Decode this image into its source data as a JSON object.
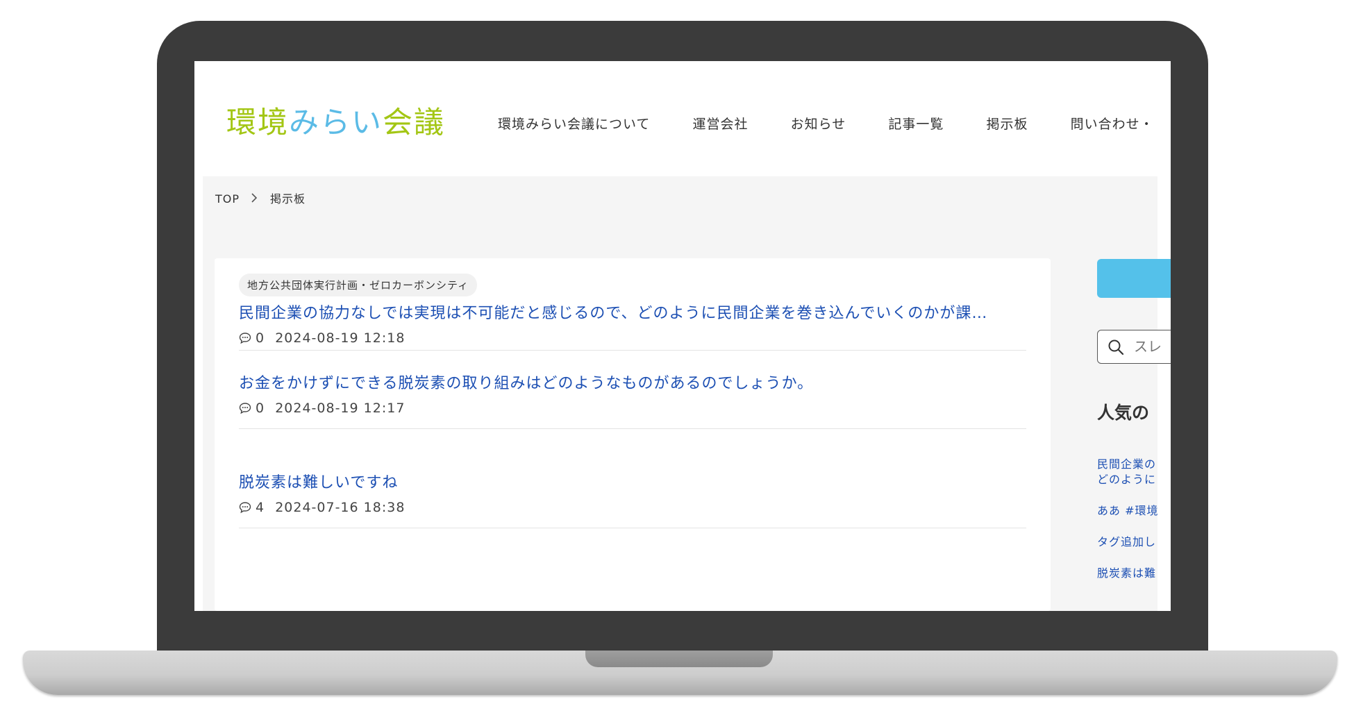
{
  "header": {
    "logo": {
      "part1": "環境",
      "part2": "みらい",
      "part3": "会議"
    },
    "nav": [
      "環境みらい会議について",
      "運営会社",
      "お知らせ",
      "記事一覧",
      "掲示板",
      "問い合わせ・"
    ]
  },
  "breadcrumb": {
    "home": "TOP",
    "current": "掲示板"
  },
  "posts": [
    {
      "category": "地方公共団体実行計画・ゼロカーボンシティ",
      "title": "民間企業の協力なしでは実現は不可能だと感じるので、どのように民間企業を巻き込んでいくのかが課…",
      "comments": "0",
      "date": "2024-08-19 12:18"
    },
    {
      "title": "お金をかけずにできる脱炭素の取り組みはどのようなものがあるのでしょうか。",
      "comments": "0",
      "date": "2024-08-19 12:17"
    },
    {
      "title": "脱炭素は難しいですね",
      "comments": "4",
      "date": "2024-07-16 18:38"
    }
  ],
  "sidebar": {
    "search_placeholder": "スレ",
    "heading": "人気の",
    "links": [
      "民間企業の",
      "どのように",
      "ああ #環境",
      "タグ追加し",
      "脱炭素は難"
    ]
  },
  "colors": {
    "logo_green": "#a3c614",
    "logo_blue": "#5bbbe6",
    "link_blue": "#1c4fb3",
    "sidebar_button": "#54c1ea",
    "bezel": "#3b3b3b"
  },
  "icons": {
    "comment": "speech-bubble-icon",
    "search": "magnifier-icon",
    "breadcrumb_separator": "chevron-right-icon"
  }
}
